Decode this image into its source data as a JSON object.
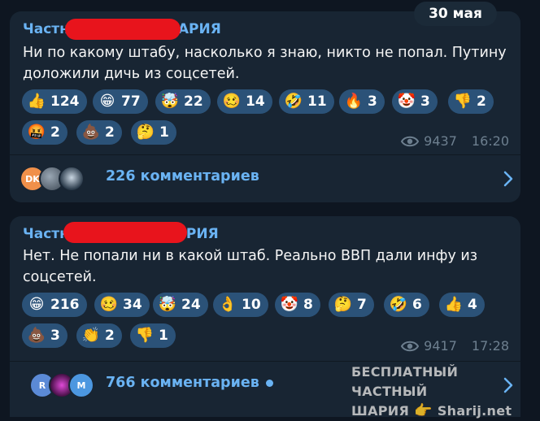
{
  "date_badge": "30 мая",
  "posts": [
    {
      "author_prefix": "Частн",
      "author_suffix": "АРИЯ",
      "text": "Ни по какому штабу, насколько я знаю, никто не попал. Путину доложили дичь из соцсетей.",
      "reactions": [
        {
          "emoji": "👍",
          "count": "124"
        },
        {
          "emoji": "😁",
          "count": "77"
        },
        {
          "emoji": "🤯",
          "count": "22"
        },
        {
          "emoji": "🥴",
          "count": "14"
        },
        {
          "emoji": "🤣",
          "count": "11"
        },
        {
          "emoji": "🔥",
          "count": "3"
        },
        {
          "emoji": "🤡",
          "count": "3"
        },
        {
          "emoji": "👎",
          "count": "2"
        },
        {
          "emoji": "🤬",
          "count": "2"
        },
        {
          "emoji": "💩",
          "count": "2"
        },
        {
          "emoji": "🤔",
          "count": "1"
        }
      ],
      "views": "9437",
      "time": "16:20",
      "avatars": [
        {
          "initials": "DK"
        },
        {
          "initials": ""
        },
        {
          "initials": ""
        }
      ],
      "comments_label": "226 комментариев",
      "has_unread": false
    },
    {
      "author_prefix": "Частн",
      "author_suffix": "РИЯ",
      "text": "Нет. Не попали ни в какой штаб. Реально ВВП дали инфу из соцсетей.",
      "reactions": [
        {
          "emoji": "😁",
          "count": "216"
        },
        {
          "emoji": "🥴",
          "count": "34"
        },
        {
          "emoji": "🤯",
          "count": "24"
        },
        {
          "emoji": "👌",
          "count": "10"
        },
        {
          "emoji": "🤡",
          "count": "8"
        },
        {
          "emoji": "🤔",
          "count": "7"
        },
        {
          "emoji": "🤣",
          "count": "6"
        },
        {
          "emoji": "👍",
          "count": "4"
        },
        {
          "emoji": "💩",
          "count": "3"
        },
        {
          "emoji": "👏",
          "count": "2"
        },
        {
          "emoji": "👎",
          "count": "1"
        }
      ],
      "views": "9417",
      "time": "17:28",
      "avatars": [
        {
          "initials": "R"
        },
        {
          "initials": ""
        },
        {
          "initials": "M"
        }
      ],
      "comments_label": "766 комментариев",
      "has_unread": true
    }
  ],
  "watermark": {
    "line1": "БЕСПЛАТНЫЙ ЧАСТНЫЙ",
    "line2_left": "ШАРИЯ",
    "line2_icon": "👉",
    "line2_right": "Sharij.net"
  },
  "colors": {
    "background": "#0e1621",
    "bubble": "#182533",
    "reaction_pill": "#2b5278",
    "accent": "#6ab3f3",
    "meta": "#6d7f8f",
    "redaction": "#e8141c"
  }
}
